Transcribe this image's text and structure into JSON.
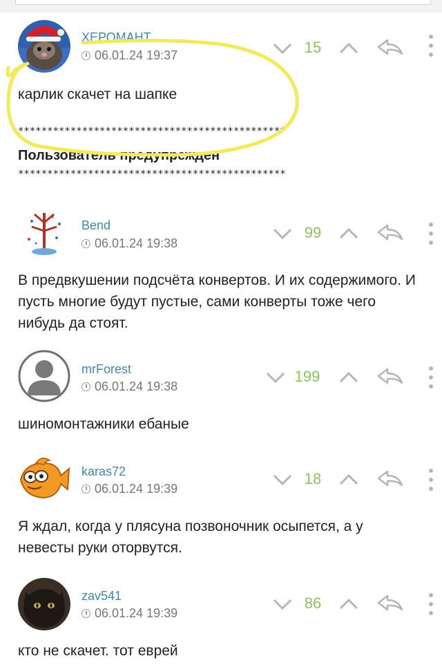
{
  "comments": [
    {
      "username": "ХЕРОМАНТ",
      "date": "06.01.24 19:37",
      "rating": "15",
      "text": "карлик скачет на шапке",
      "stars_top": "**********************************************",
      "warning": "Пользователь предупрежден",
      "stars_bottom": "**********************************************"
    },
    {
      "username": "Bend",
      "date": "06.01.24 19:38",
      "rating": "99",
      "text": "В предвкушении подсчёта конвертов. И их содержимого. И пусть многие будут пустые, сами конверты тоже чего нибудь да стоят."
    },
    {
      "username": "mrForest",
      "date": "06.01.24 19:38",
      "rating": "199",
      "text": "шиномонтажники ебаные"
    },
    {
      "username": "karas72",
      "date": "06.01.24 19:39",
      "rating": "18",
      "text": "Я ждал, когда у плясуна позвоночник осыпется, а у невесты руки оторвутся."
    },
    {
      "username": "zav541",
      "date": "06.01.24 19:39",
      "rating": "86",
      "text": "кто не скачет. тот еврей"
    }
  ],
  "colors": {
    "username": "#3f87b8",
    "rating": "#8dc25a",
    "icons": "#b5b5b5",
    "highlight": "#f2ea5a"
  }
}
